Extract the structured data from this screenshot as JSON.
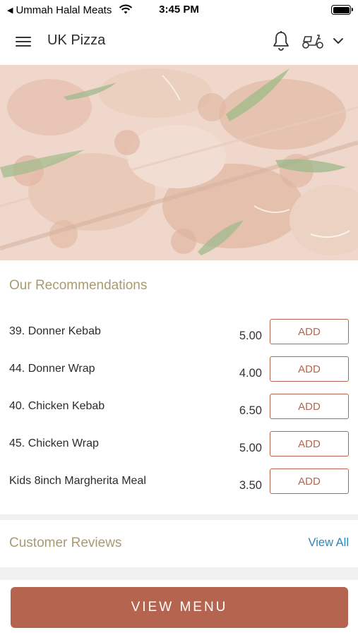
{
  "status_bar": {
    "back_label": "Ummah Halal Meats",
    "time": "3:45 PM"
  },
  "header": {
    "title": "UK Pizza",
    "icons": [
      "menu-icon",
      "bell-icon",
      "scooter-icon",
      "chevron-down-icon"
    ]
  },
  "recommendations": {
    "title": "Our Recommendations",
    "items": [
      {
        "name": "39. Donner Kebab",
        "price": "5.00",
        "add_label": "ADD"
      },
      {
        "name": "44. Donner Wrap",
        "price": "4.00",
        "add_label": "ADD"
      },
      {
        "name": "40. Chicken Kebab",
        "price": "6.50",
        "add_label": "ADD"
      },
      {
        "name": "45. Chicken Wrap",
        "price": "5.00",
        "add_label": "ADD"
      },
      {
        "name": "Kids 8inch Margherita Meal",
        "price": "3.50",
        "add_label": "ADD"
      }
    ]
  },
  "reviews": {
    "title": "Customer Reviews",
    "view_all_label": "View All"
  },
  "footer": {
    "view_menu_label": "VIEW MENU"
  },
  "colors": {
    "accent": "#b5654f",
    "section_title": "#a99a72",
    "link": "#2d86b7"
  }
}
